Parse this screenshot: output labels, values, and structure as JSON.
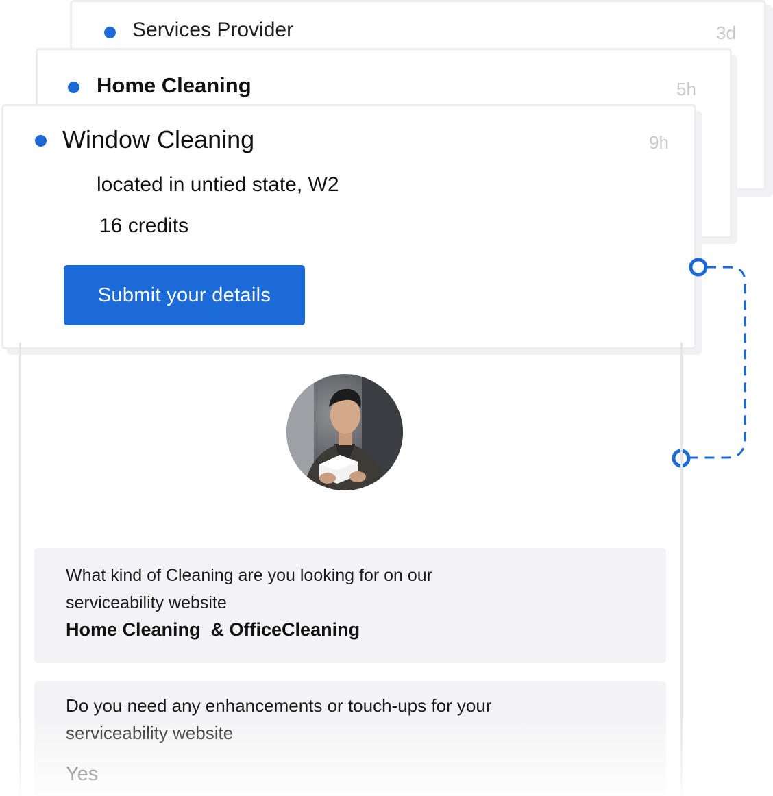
{
  "cards": [
    {
      "title": "Services Provider",
      "time": "3d"
    },
    {
      "title": "Home Cleaning",
      "time": "5h"
    },
    {
      "title": "Window Cleaning",
      "time": "9h"
    }
  ],
  "active_card": {
    "location": "located in untied state, W2",
    "credits": "16 credits",
    "submit_label": "Submit your details"
  },
  "questions": [
    {
      "question": "What kind of Cleaning are you looking for on our serviceability website",
      "answer": "Home Cleaning  & OfficeCleaning"
    },
    {
      "question": "Do you need any enhancements or touch-ups for your serviceability website",
      "answer": "Yes"
    }
  ],
  "colors": {
    "accent": "#1b6ad8",
    "muted_time": "#c9c9cc",
    "qa_background": "#f3f3f5"
  },
  "icons": {
    "status": "blue-dot-icon",
    "connector": "dashed-connector-icon",
    "avatar": "user-avatar"
  }
}
